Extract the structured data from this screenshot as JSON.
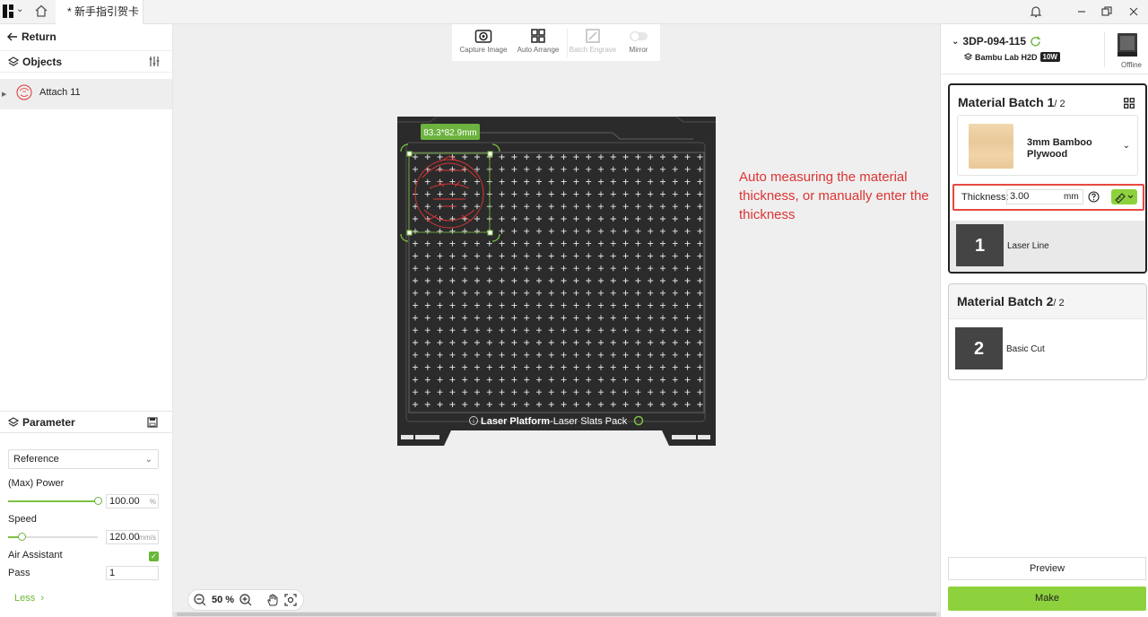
{
  "titlebar": {
    "tab_title": "* 新手指引贺卡"
  },
  "left_panel": {
    "return_label": "Return",
    "objects_label": "Objects",
    "object_items": [
      {
        "label": "Attach 11"
      }
    ],
    "parameter_label": "Parameter",
    "preset_selected": "Reference",
    "power_label": "(Max) Power",
    "power_value": "100.00",
    "power_unit": "%",
    "power_level_fraction": 1.0,
    "speed_label": "Speed",
    "speed_value": "120.00",
    "speed_unit": "mm/s",
    "speed_level_fraction": 0.15,
    "air_assist_label": "Air Assistant",
    "air_assist_checked": true,
    "pass_label": "Pass",
    "pass_value": "1",
    "less_label": "Less"
  },
  "toolbar": {
    "capture_label": "Capture Image",
    "arrange_label": "Auto Arrange",
    "batch_engrave_label": "Batch Engrave",
    "mirror_label": "Mirror"
  },
  "canvas": {
    "dimension_label": "83.3*82.9mm",
    "plate_name_bold": "Laser Platform",
    "plate_name_rest": "-Laser Slats Pack",
    "annotation": "Auto measuring the material thickness, or manually enter the thickness",
    "zoom_level": "50 %"
  },
  "right_panel": {
    "printer_name": "3DP-094-115",
    "printer_model": "Bambu Lab H2D",
    "laser_power_badge": "10W",
    "status": "Offline",
    "batch1": {
      "title": "Material Batch 1",
      "total": "/ 2",
      "material_name": "3mm Bamboo Plywood",
      "thickness_label": "Thickness:",
      "thickness_value": "3.00",
      "thickness_unit": "mm",
      "process_number": "1",
      "process_label": "Laser Line"
    },
    "batch2": {
      "title": "Material Batch 2",
      "total": "/ 2",
      "process_number": "2",
      "process_label": "Basic Cut"
    },
    "preview_label": "Preview",
    "make_label": "Make"
  },
  "colors": {
    "accent_green": "#8dd23d",
    "annotation_red": "#d33333",
    "highlight_border": "#e8483f",
    "plate_dark": "#2a2a2a"
  }
}
